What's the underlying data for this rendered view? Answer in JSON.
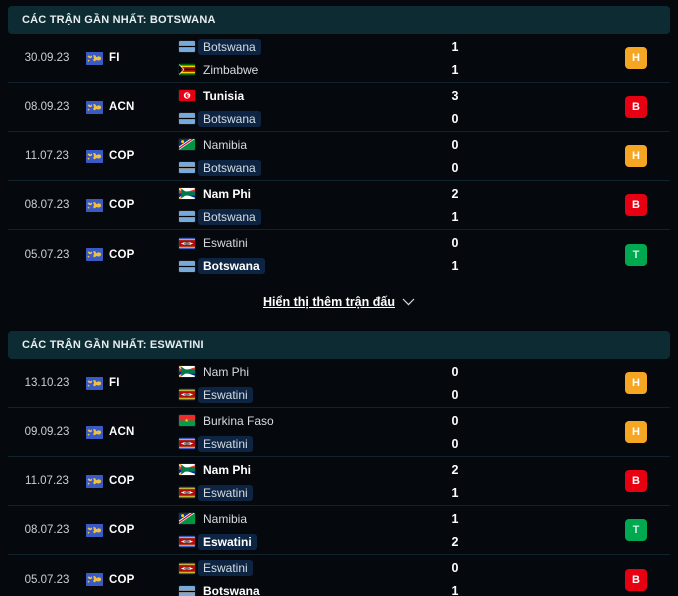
{
  "sections": [
    {
      "title": "CÁC TRẬN GẦN NHẤT: BOTSWANA",
      "matches": [
        {
          "date": "30.09.23",
          "competition": "FI",
          "competition_icon": "world-map-icon",
          "home": {
            "team": "Botswana",
            "flag": "botswana",
            "bold": false,
            "highlight": true
          },
          "away": {
            "team": "Zimbabwe",
            "flag": "zimbabwe",
            "bold": false,
            "highlight": false
          },
          "home_score": "1",
          "away_score": "1",
          "result": "H",
          "result_color": "#f5a623"
        },
        {
          "date": "08.09.23",
          "competition": "ACN",
          "competition_icon": "world-map-icon",
          "home": {
            "team": "Tunisia",
            "flag": "tunisia",
            "bold": true,
            "highlight": false
          },
          "away": {
            "team": "Botswana",
            "flag": "botswana",
            "bold": false,
            "highlight": true
          },
          "home_score": "3",
          "away_score": "0",
          "result": "B",
          "result_color": "#e60012"
        },
        {
          "date": "11.07.23",
          "competition": "COP",
          "competition_icon": "world-map-icon",
          "home": {
            "team": "Namibia",
            "flag": "namibia",
            "bold": false,
            "highlight": false
          },
          "away": {
            "team": "Botswana",
            "flag": "botswana",
            "bold": false,
            "highlight": true
          },
          "home_score": "0",
          "away_score": "0",
          "result": "H",
          "result_color": "#f5a623"
        },
        {
          "date": "08.07.23",
          "competition": "COP",
          "competition_icon": "world-map-icon",
          "home": {
            "team": "Nam Phi",
            "flag": "southafrica",
            "bold": true,
            "highlight": false
          },
          "away": {
            "team": "Botswana",
            "flag": "botswana",
            "bold": false,
            "highlight": true
          },
          "home_score": "2",
          "away_score": "1",
          "result": "B",
          "result_color": "#e60012"
        },
        {
          "date": "05.07.23",
          "competition": "COP",
          "competition_icon": "world-map-icon",
          "home": {
            "team": "Eswatini",
            "flag": "eswatini",
            "bold": false,
            "highlight": false
          },
          "away": {
            "team": "Botswana",
            "flag": "botswana",
            "bold": true,
            "highlight": true
          },
          "home_score": "0",
          "away_score": "1",
          "result": "T",
          "result_color": "#00a94f"
        }
      ],
      "show_more": {
        "label": "Hiển thị thêm trận đấu",
        "icon": "chevron-down-icon"
      }
    },
    {
      "title": "CÁC TRẬN GẦN NHẤT: ESWATINI",
      "matches": [
        {
          "date": "13.10.23",
          "competition": "FI",
          "competition_icon": "world-map-icon",
          "home": {
            "team": "Nam Phi",
            "flag": "southafrica",
            "bold": false,
            "highlight": false
          },
          "away": {
            "team": "Eswatini",
            "flag": "eswatini",
            "bold": false,
            "highlight": true
          },
          "home_score": "0",
          "away_score": "0",
          "result": "H",
          "result_color": "#f5a623"
        },
        {
          "date": "09.09.23",
          "competition": "ACN",
          "competition_icon": "world-map-icon",
          "home": {
            "team": "Burkina Faso",
            "flag": "burkinafaso",
            "bold": false,
            "highlight": false
          },
          "away": {
            "team": "Eswatini",
            "flag": "eswatini",
            "bold": false,
            "highlight": true
          },
          "home_score": "0",
          "away_score": "0",
          "result": "H",
          "result_color": "#f5a623"
        },
        {
          "date": "11.07.23",
          "competition": "COP",
          "competition_icon": "world-map-icon",
          "home": {
            "team": "Nam Phi",
            "flag": "southafrica",
            "bold": true,
            "highlight": false
          },
          "away": {
            "team": "Eswatini",
            "flag": "eswatini",
            "bold": false,
            "highlight": true
          },
          "home_score": "2",
          "away_score": "1",
          "result": "B",
          "result_color": "#e60012"
        },
        {
          "date": "08.07.23",
          "competition": "COP",
          "competition_icon": "world-map-icon",
          "home": {
            "team": "Namibia",
            "flag": "namibia",
            "bold": false,
            "highlight": false
          },
          "away": {
            "team": "Eswatini",
            "flag": "eswatini",
            "bold": true,
            "highlight": true
          },
          "home_score": "1",
          "away_score": "2",
          "result": "T",
          "result_color": "#00a94f"
        },
        {
          "date": "05.07.23",
          "competition": "COP",
          "competition_icon": "world-map-icon",
          "home": {
            "team": "Eswatini",
            "flag": "eswatini",
            "bold": false,
            "highlight": true
          },
          "away": {
            "team": "Botswana",
            "flag": "botswana",
            "bold": true,
            "highlight": false
          },
          "home_score": "0",
          "away_score": "1",
          "result": "B",
          "result_color": "#e60012"
        }
      ]
    }
  ],
  "theme": {
    "page_bg": "#05080d",
    "header_bg": "#0d2b33",
    "row_divider": "#12222c",
    "highlight_pill": "#0d2542",
    "text_primary": "#ffffff",
    "text_secondary": "#c9d2d8"
  }
}
